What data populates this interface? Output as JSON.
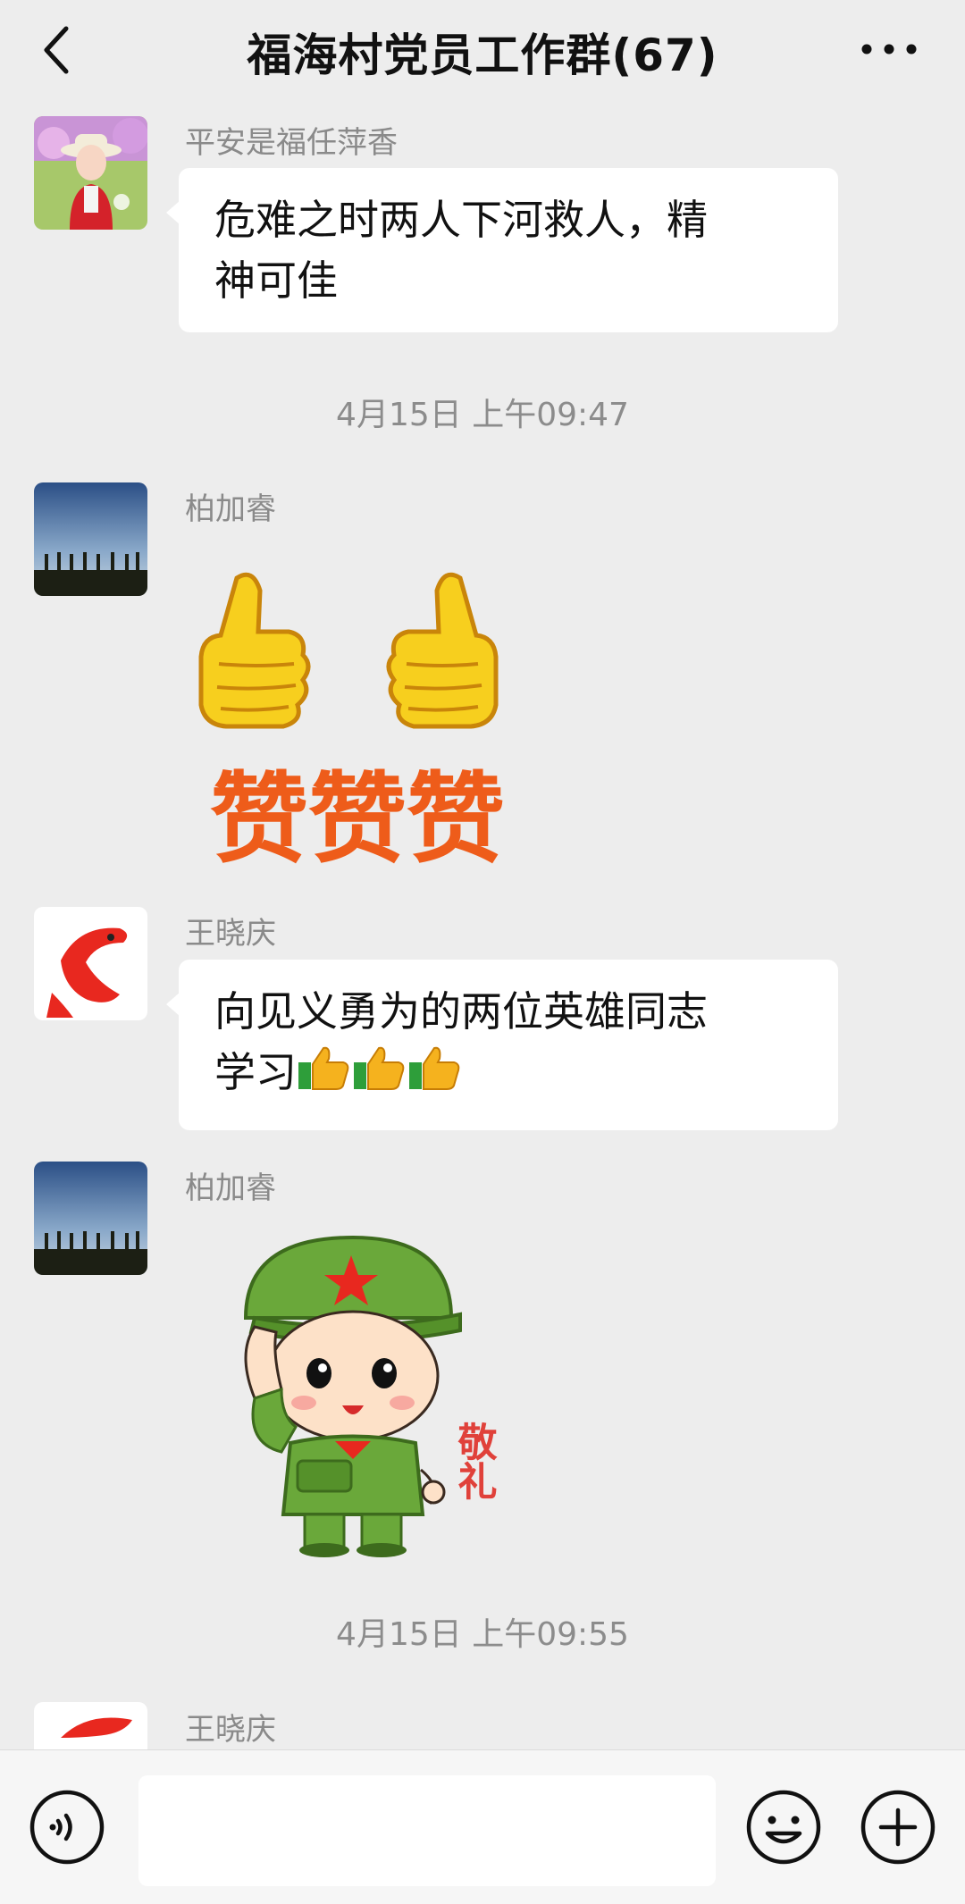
{
  "header": {
    "title": "福海村党员工作群(67)"
  },
  "messages": [
    {
      "sender": "平安是福任萍香",
      "text_line1": "危难之时两人下河救人，精",
      "text_line2": "神可佳"
    },
    {
      "timestamp": "4月15日 上午09:47"
    },
    {
      "sender": "柏加睿",
      "sticker_text": "赞赞赞"
    },
    {
      "sender": "王晓庆",
      "text_line1": "向见义勇为的两位英雄同志",
      "text_line2": "学习"
    },
    {
      "sender": "柏加睿",
      "sticker_text": "敬礼"
    },
    {
      "timestamp": "4月15日 上午09:55"
    },
    {
      "sender": "王晓庆"
    }
  ],
  "input": {
    "value": ""
  },
  "icons": {
    "back": "back-arrow-icon",
    "more": "more-dots-icon",
    "voice": "voice-icon",
    "emoji": "emoji-icon",
    "plus": "plus-icon",
    "thumbs": "thumbs-up-icon"
  }
}
